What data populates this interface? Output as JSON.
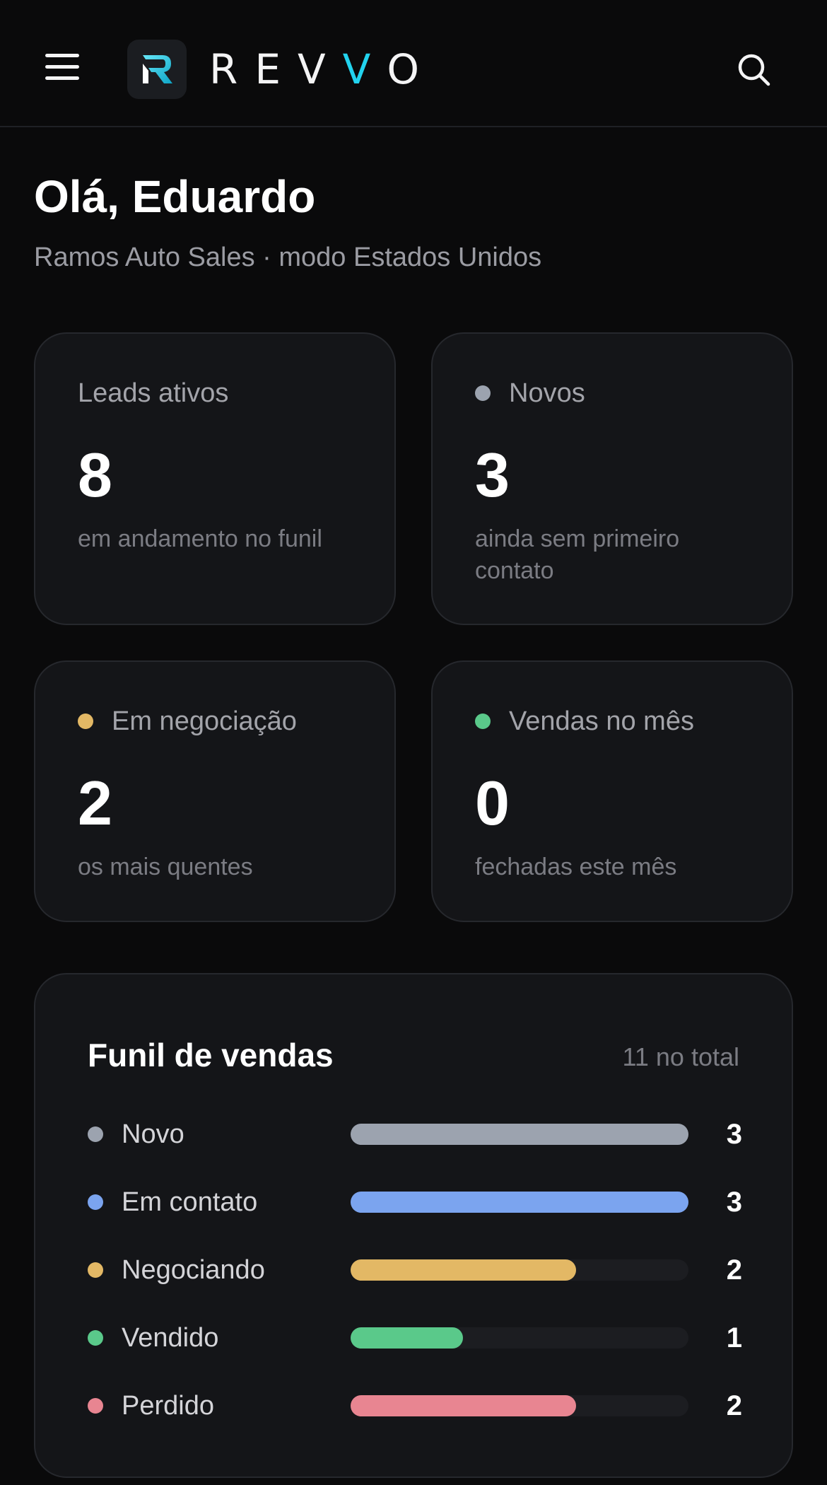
{
  "header": {
    "logo_text": "REVVO",
    "menu_icon": "hamburger-menu-icon",
    "search_icon": "search-icon"
  },
  "greeting": {
    "title": "Olá, Eduardo",
    "subtitle": "Ramos Auto Sales · modo Estados Unidos"
  },
  "stats": [
    {
      "label": "Leads ativos",
      "value": "8",
      "description": "em andamento no funil",
      "dot_color": null
    },
    {
      "label": "Novos",
      "value": "3",
      "description": "ainda sem primeiro contato",
      "dot_color": "#9ca3af"
    },
    {
      "label": "Em negociação",
      "value": "2",
      "description": "os mais quentes",
      "dot_color": "#e3b865"
    },
    {
      "label": "Vendas no mês",
      "value": "0",
      "description": "fechadas este mês",
      "dot_color": "#5ac98a"
    }
  ],
  "funnel": {
    "title": "Funil de vendas",
    "total_label": "11 no total",
    "max": 3,
    "stages": [
      {
        "label": "Novo",
        "count": "3",
        "value": 3,
        "color": "#9ca3af"
      },
      {
        "label": "Em contato",
        "count": "3",
        "value": 3,
        "color": "#7ba4ef"
      },
      {
        "label": "Negociando",
        "count": "2",
        "value": 2,
        "color": "#e3b865"
      },
      {
        "label": "Vendido",
        "count": "1",
        "value": 1,
        "color": "#5ac98a"
      },
      {
        "label": "Perdido",
        "count": "2",
        "value": 2,
        "color": "#e88591"
      }
    ]
  },
  "colors": {
    "background": "#0a0a0b",
    "card": "#141518",
    "accent": "#22d3ee"
  }
}
